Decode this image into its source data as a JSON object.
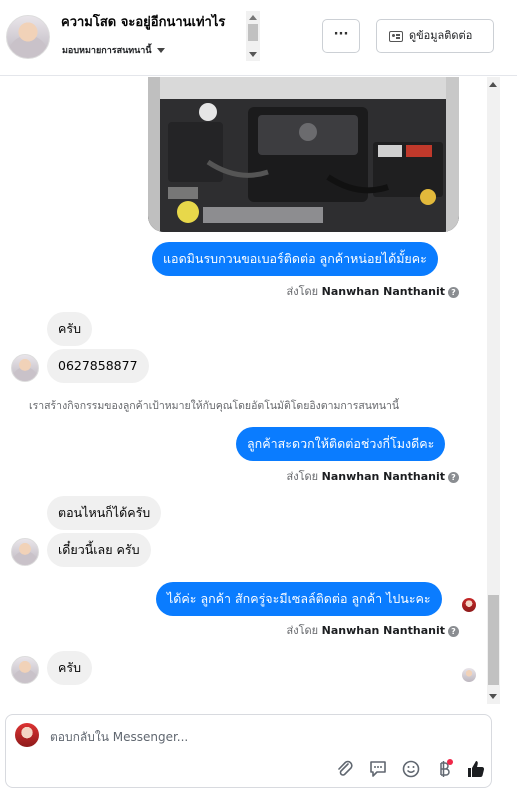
{
  "header": {
    "contact_name": "ความโสด จะอยู่อีกนานเท่าไร",
    "assign_label": "มอบหมายการสนทนานี้",
    "more_label": "···",
    "contact_info_label": "ดูข้อมูลติดต่อ"
  },
  "messages": {
    "m1": "แอดมินรบกวนขอเบอร์ติดต่อ ลูกค้าหน่อยได้มั้ยคะ",
    "sent_by_1_prefix": "ส่งโดย ",
    "sent_by_1_name": "Nanwhan Nanthanit",
    "m2": "ครับ",
    "m3": "0627858877",
    "system_note": "เราสร้างกิจกรรมของลูกค้าเป้าหมายให้กับคุณโดยอัตโนมัติโดยอิงตามการสนทนานี้",
    "m4": "ลูกค้าสะดวกให้ติดต่อช่วงกี่โมงดีคะ",
    "sent_by_2_prefix": "ส่งโดย ",
    "sent_by_2_name": "Nanwhan Nanthanit",
    "m5": "ตอนไหนก็ได้ครับ",
    "m6": "เดี๋ยวนี้เลย ครับ",
    "m7": "ได้ค่ะ ลูกค้า สักครู่จะมีเซลล์ติดต่อ ลูกค้า ไปนะคะ",
    "sent_by_3_prefix": "ส่งโดย ",
    "sent_by_3_name": "Nanwhan Nanthanit",
    "m8": "ครับ",
    "info_glyph": "?"
  },
  "composer": {
    "placeholder": "ตอบกลับใน Messenger..."
  },
  "colors": {
    "outgoing_bubble": "#0a7cff",
    "incoming_bubble": "#f0f0f0",
    "like_icon": "#1c1e21",
    "notification_dot": "#f02849"
  },
  "icons": [
    "more-icon",
    "contact-card-icon",
    "attach-icon",
    "saved-reply-icon",
    "emoji-icon",
    "baht-icon",
    "thumbs-up-icon"
  ]
}
